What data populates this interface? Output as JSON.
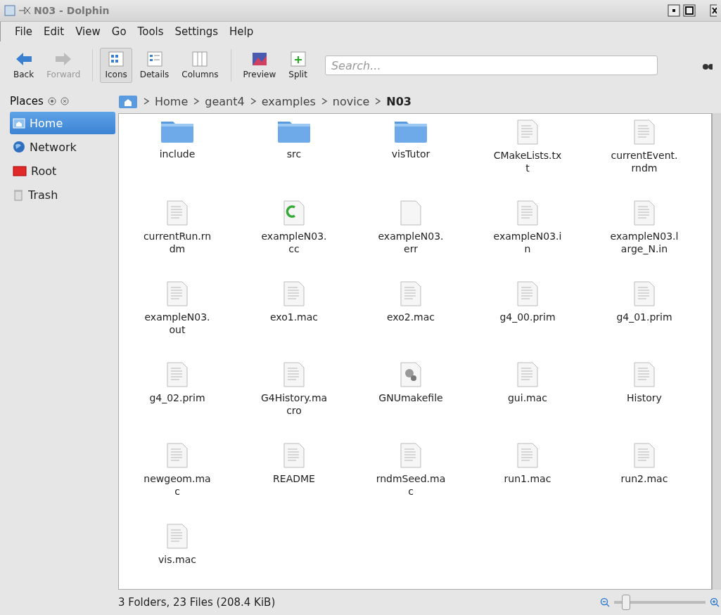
{
  "window": {
    "title": "N03 - Dolphin"
  },
  "menu": [
    "File",
    "Edit",
    "View",
    "Go",
    "Tools",
    "Settings",
    "Help"
  ],
  "toolbar": [
    {
      "kind": "back",
      "label": "Back",
      "disabled": false,
      "selected": false
    },
    {
      "kind": "forward",
      "label": "Forward",
      "disabled": true,
      "selected": false
    },
    {
      "kind": "icons",
      "label": "Icons",
      "disabled": false,
      "selected": true
    },
    {
      "kind": "details",
      "label": "Details",
      "disabled": false,
      "selected": false
    },
    {
      "kind": "columns",
      "label": "Columns",
      "disabled": false,
      "selected": false
    },
    {
      "kind": "preview",
      "label": "Preview",
      "disabled": false,
      "selected": false
    },
    {
      "kind": "split",
      "label": "Split",
      "disabled": false,
      "selected": false
    }
  ],
  "search": {
    "placeholder": "Search..."
  },
  "places": {
    "title": "Places",
    "items": [
      {
        "kind": "home",
        "label": "Home",
        "selected": true
      },
      {
        "kind": "network",
        "label": "Network",
        "selected": false
      },
      {
        "kind": "root",
        "label": "Root",
        "selected": false
      },
      {
        "kind": "trash",
        "label": "Trash",
        "selected": false
      }
    ]
  },
  "breadcrumb": [
    {
      "label": "Home",
      "current": false
    },
    {
      "label": "geant4",
      "current": false
    },
    {
      "label": "examples",
      "current": false
    },
    {
      "label": "novice",
      "current": false
    },
    {
      "label": "N03",
      "current": true
    }
  ],
  "files": [
    {
      "kind": "folder",
      "name": "include"
    },
    {
      "kind": "folder",
      "name": "src"
    },
    {
      "kind": "folder",
      "name": "visTutor"
    },
    {
      "kind": "text",
      "name": "CMakeLists.txt"
    },
    {
      "kind": "text",
      "name": "currentEvent.rndm"
    },
    {
      "kind": "text",
      "name": "currentRun.rndm"
    },
    {
      "kind": "cpp",
      "name": "exampleN03.cc"
    },
    {
      "kind": "blank",
      "name": "exampleN03.err"
    },
    {
      "kind": "text",
      "name": "exampleN03.in"
    },
    {
      "kind": "text",
      "name": "exampleN03.large_N.in"
    },
    {
      "kind": "text",
      "name": "exampleN03.out"
    },
    {
      "kind": "text",
      "name": "exo1.mac"
    },
    {
      "kind": "text",
      "name": "exo2.mac"
    },
    {
      "kind": "text",
      "name": "g4_00.prim"
    },
    {
      "kind": "text",
      "name": "g4_01.prim"
    },
    {
      "kind": "text",
      "name": "g4_02.prim"
    },
    {
      "kind": "text",
      "name": "G4History.macro"
    },
    {
      "kind": "make",
      "name": "GNUmakefile"
    },
    {
      "kind": "text",
      "name": "gui.mac"
    },
    {
      "kind": "text",
      "name": "History"
    },
    {
      "kind": "text",
      "name": "newgeom.mac"
    },
    {
      "kind": "text",
      "name": "README"
    },
    {
      "kind": "text",
      "name": "rndmSeed.mac"
    },
    {
      "kind": "text",
      "name": "run1.mac"
    },
    {
      "kind": "text",
      "name": "run2.mac"
    },
    {
      "kind": "text",
      "name": "vis.mac"
    }
  ],
  "status_bar": {
    "text": "3 Folders, 23 Files (208.4 KiB)",
    "zoom": {
      "level": 0.12
    }
  }
}
